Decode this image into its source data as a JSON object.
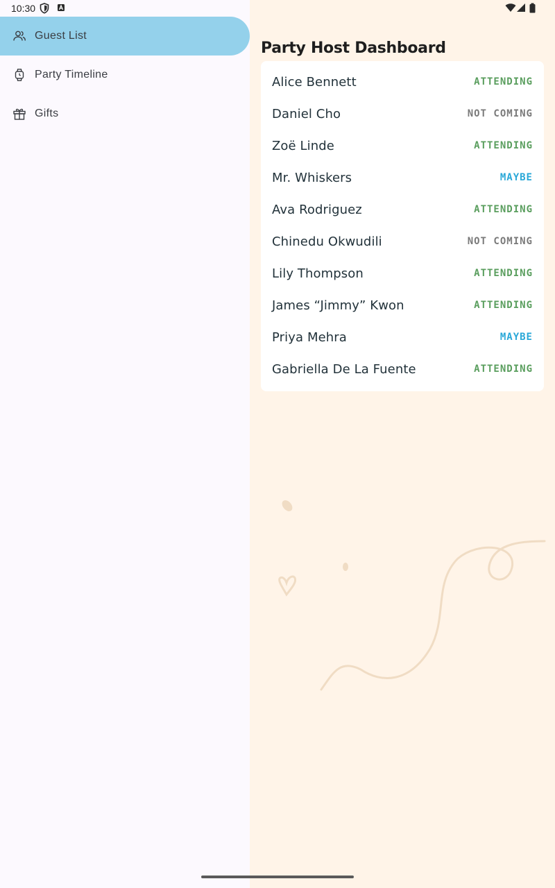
{
  "status_bar": {
    "time": "10:30"
  },
  "drawer": {
    "items": [
      {
        "label": "Guest List",
        "icon": "people-icon",
        "active": true
      },
      {
        "label": "Party Timeline",
        "icon": "watch-icon",
        "active": false
      },
      {
        "label": "Gifts",
        "icon": "gift-icon",
        "active": false
      }
    ]
  },
  "main": {
    "title": "Party Host Dashboard",
    "guests": [
      {
        "name": "Alice Bennett",
        "status": "ATTENDING"
      },
      {
        "name": "Daniel Cho",
        "status": "NOT COMING"
      },
      {
        "name": "Zoë Linde",
        "status": "ATTENDING"
      },
      {
        "name": "Mr. Whiskers",
        "status": "MAYBE"
      },
      {
        "name": "Ava Rodriguez",
        "status": "ATTENDING"
      },
      {
        "name": "Chinedu Okwudili",
        "status": "NOT COMING"
      },
      {
        "name": "Lily Thompson",
        "status": "ATTENDING"
      },
      {
        "name": "James “Jimmy” Kwon",
        "status": "ATTENDING"
      },
      {
        "name": "Priya Mehra",
        "status": "MAYBE"
      },
      {
        "name": "Gabriella De La Fuente",
        "status": "ATTENDING"
      }
    ]
  },
  "colors": {
    "accent": "#94D1EB",
    "background": "#FFF4E8",
    "drawer_bg": "#FCF9FE",
    "attending": "#5A9E5E",
    "not_coming": "#7A7A7A",
    "maybe": "#2AA8D8",
    "decoration": "#F0DCC4"
  }
}
